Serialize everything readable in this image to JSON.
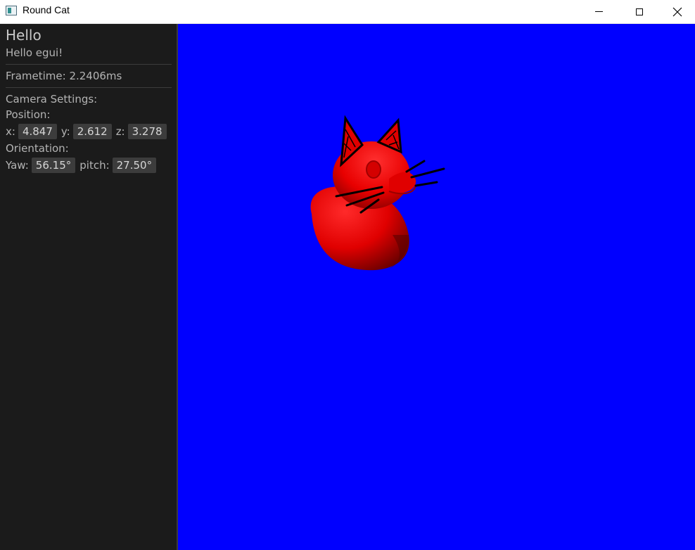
{
  "window": {
    "title": "Round Cat",
    "icon": "app-window-icon",
    "controls": [
      "minimize-icon",
      "maximize-icon",
      "close-icon"
    ]
  },
  "panel": {
    "heading": "Hello",
    "greeting": "Hello egui!",
    "frametime": "Frametime: 2.2406ms",
    "camera_label": "Camera Settings:",
    "position_label": "Position:",
    "position": {
      "x_label": "x:",
      "x": "4.847",
      "y_label": "y:",
      "y": "2.612",
      "z_label": "z:",
      "z": "3.278"
    },
    "orientation_label": "Orientation:",
    "orientation": {
      "yaw_label": "Yaw:",
      "yaw": "56.15°",
      "pitch_label": "pitch:",
      "pitch": "27.50°"
    }
  },
  "viewport": {
    "background": "#0000ff",
    "model_color": "#ff0000",
    "model": "round-cat-duck-model"
  }
}
